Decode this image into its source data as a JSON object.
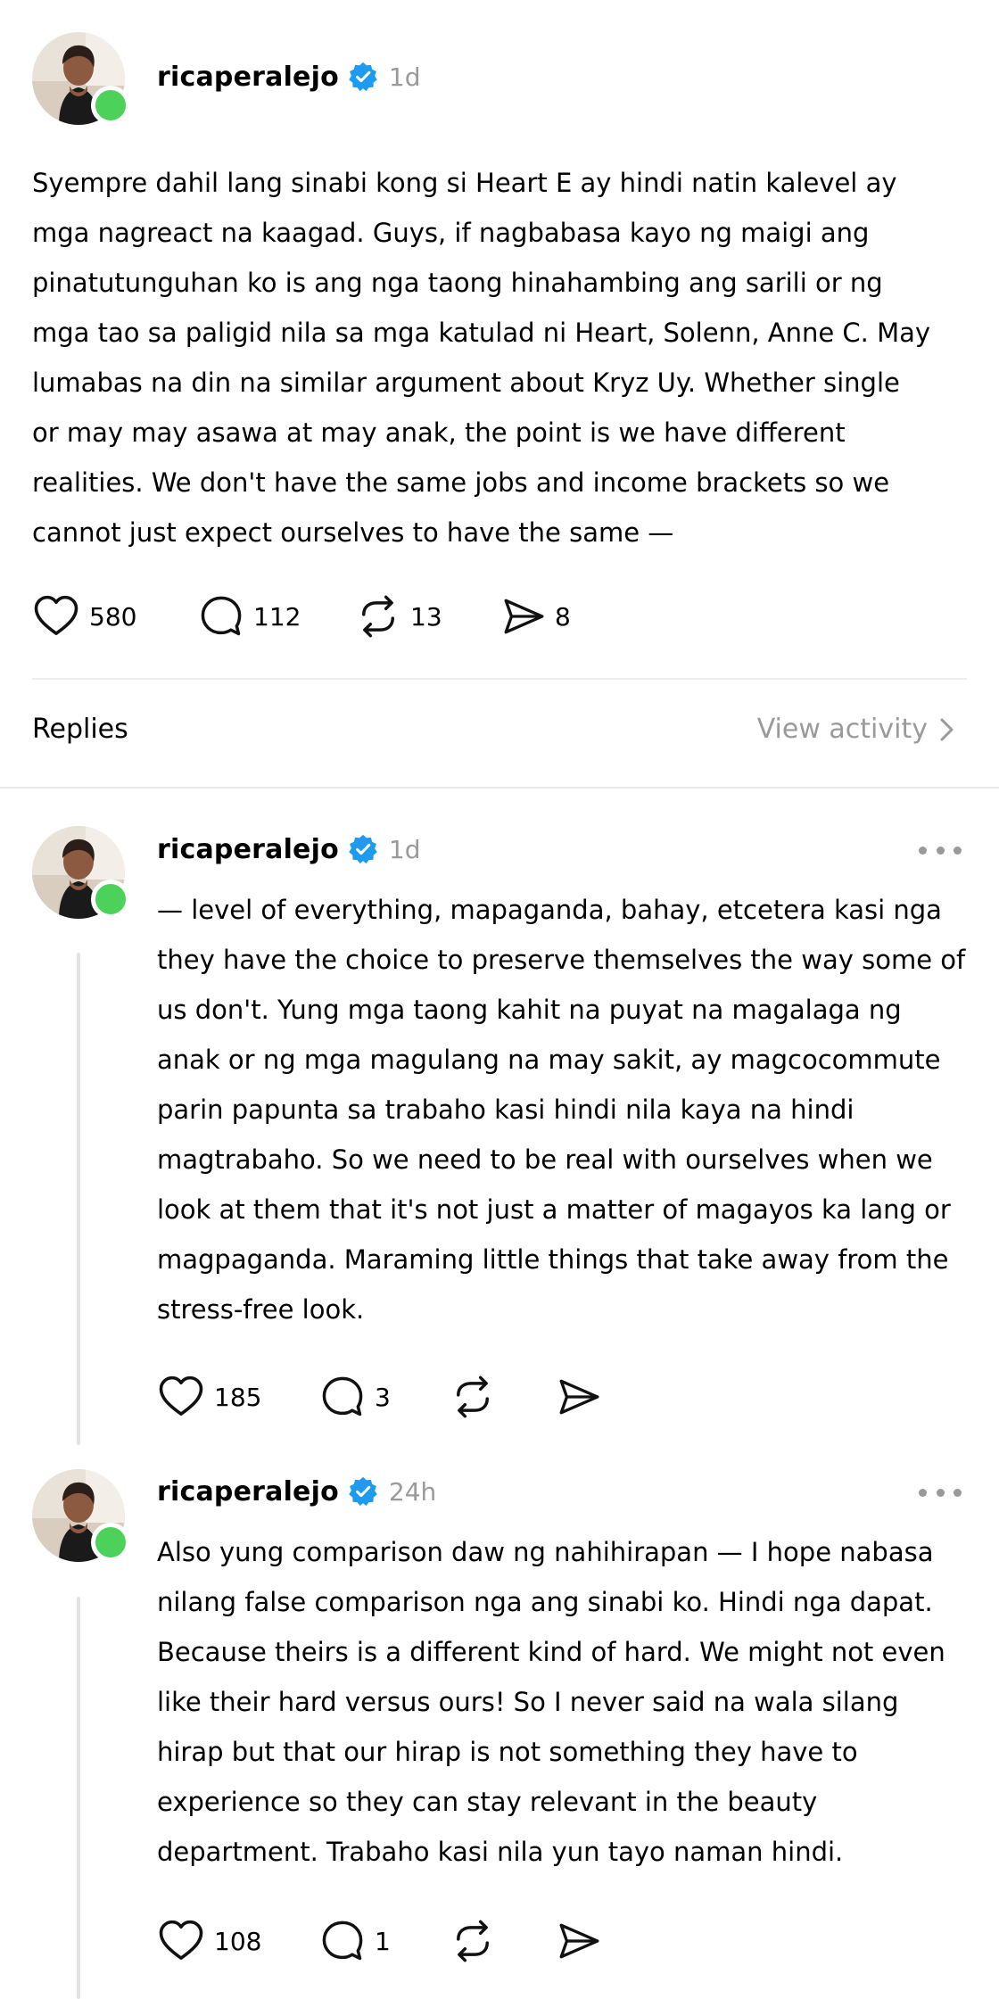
{
  "main_post": {
    "username": "ricaperalejo",
    "time": "1d",
    "text": "Syempre dahil lang sinabi kong si Heart E ay hindi natin kalevel ay mga nagreact na kaagad. Guys, if nagbabasa kayo ng maigi ang pinatutunguhan ko is ang nga taong hinahambing ang sarili or ng mga tao sa paligid nila sa mga katulad ni Heart, Solenn, Anne C. May lumabas na din na similar argument about Kryz Uy. Whether single or may may asawa at may anak, the point is we have different realities. We don't have the same jobs and income brackets so we cannot just expect ourselves to have the same —",
    "likes": "580",
    "comments": "112",
    "reposts": "13",
    "shares": "8"
  },
  "replies_bar": {
    "label": "Replies",
    "view_activity": "View activity"
  },
  "replies": [
    {
      "username": "ricaperalejo",
      "time": "1d",
      "text": "— level of everything, mapaganda, bahay, etcetera kasi nga they have the choice to preserve themselves the way some of us don't. Yung mga taong kahit na puyat na magalaga ng anak or ng mga magulang na may sakit, ay magcocommute parin papunta sa trabaho kasi hindi nila kaya na hindi magtrabaho. So we need to be real with ourselves when we look at them that it's not just a matter of magayos ka lang or magpaganda. Maraming little things that take away from the stress-free look.",
      "likes": "185",
      "comments": "3"
    },
    {
      "username": "ricaperalejo",
      "time": "24h",
      "text": "Also yung comparison daw ng nahihirapan — I hope nabasa nilang false comparison nga ang sinabi ko. Hindi nga dapat. Because theirs is a different kind of hard. We might not even like their hard versus ours! So I never said na wala silang hirap but that our hirap is not something they have to experience so they can stay relevant in the beauty department. Trabaho kasi nila yun tayo naman hindi.",
      "likes": "108",
      "comments": "1"
    }
  ],
  "icons": {
    "like": "heart-icon",
    "comment": "comment-bubble-icon",
    "repost": "repost-icon",
    "share": "send-icon",
    "verified": "verified-badge-icon",
    "more": "more-dots-icon",
    "chevron": "chevron-right-icon"
  },
  "colors": {
    "verified_blue": "#1d9bf0",
    "online_green": "#4cd25a",
    "muted_gray": "#9a9a9a"
  }
}
